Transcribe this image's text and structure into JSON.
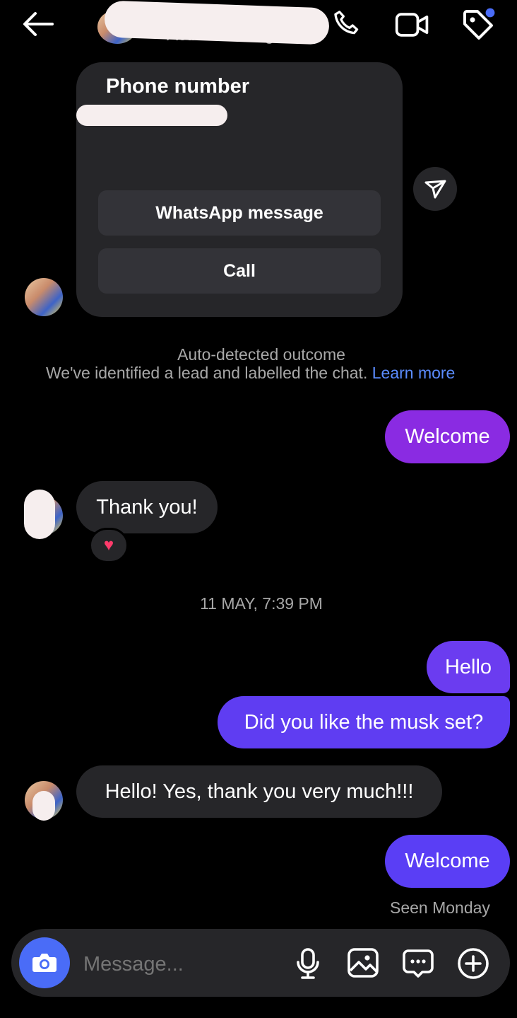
{
  "header": {
    "status": "Active 12m ago",
    "icons": [
      "back-arrow-icon",
      "phone-icon",
      "video-icon",
      "tag-icon"
    ],
    "tag_badge_color": "#4a6cf7"
  },
  "contact_card": {
    "title": "Phone number",
    "whatsapp_label": "WhatsApp message",
    "call_label": "Call"
  },
  "notice": {
    "title": "Auto-detected outcome",
    "body": "We've identified a lead and labelled the chat.",
    "link": "Learn more",
    "link_color": "#5b8cff"
  },
  "messages": [
    {
      "side": "out",
      "text": "Welcome"
    },
    {
      "side": "in",
      "text": "Thank you!",
      "reaction": "❤️"
    },
    {
      "type": "timestamp",
      "text": "11 MAY, 7:39 PM"
    },
    {
      "side": "out",
      "text": "Hello"
    },
    {
      "side": "out",
      "text": "Did you like the musk set?"
    },
    {
      "side": "in",
      "text": "Hello! Yes, thank you very much!!!"
    },
    {
      "side": "out",
      "text": "Welcome"
    }
  ],
  "seen": "Seen Monday",
  "composer": {
    "placeholder": "Message...",
    "icons": [
      "camera-icon",
      "microphone-icon",
      "gallery-icon",
      "sticker-icon",
      "add-icon"
    ],
    "camera_bg": "#4a6cf7"
  },
  "colors": {
    "outgoing_purple": "#7b2ff2",
    "outgoing_indigo": "#5a3ef5",
    "incoming": "#262629"
  }
}
